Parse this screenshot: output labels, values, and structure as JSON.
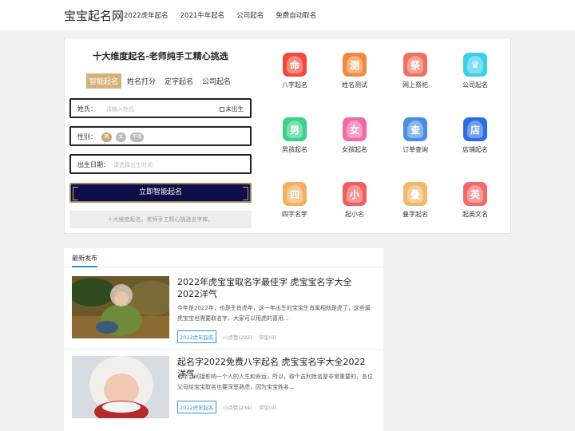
{
  "header": {
    "logo": "宝宝起名网",
    "nav": [
      "2022虎年起名",
      "2021牛年起名",
      "公司起名",
      "免费自动取名"
    ]
  },
  "form": {
    "title": "十大维度起名-老师纯手工精心挑选",
    "tabs": [
      "智能起名",
      "姓名打分",
      "定字起名",
      "公司起名"
    ],
    "surname_label": "姓氏：",
    "surname_placeholder": "请输入姓氏",
    "unborn_label": "未出生",
    "gender_label": "性别：",
    "genders": [
      "男",
      "女",
      "不限"
    ],
    "birth_label": "出生日期：",
    "birth_placeholder": "请选择出生时间",
    "submit_label": "立即智能起名",
    "note": "十大维度起名，老师手工精心挑选名字库。"
  },
  "services": [
    {
      "label": "八字起名",
      "icon": "bazi-icon",
      "glyph": "命",
      "color": "#f04a3a"
    },
    {
      "label": "姓名测试",
      "icon": "name-test-icon",
      "glyph": "测",
      "color": "#f08a3c"
    },
    {
      "label": "网上祭祀",
      "icon": "memorial-icon",
      "glyph": "祭",
      "color": "#f07060"
    },
    {
      "label": "公司起名",
      "icon": "company-crown-icon",
      "glyph": "♛",
      "color": "#3ad0e8"
    },
    {
      "label": "男孩起名",
      "icon": "boy-icon",
      "glyph": "男",
      "color": "#3cd08a"
    },
    {
      "label": "女孩起名",
      "icon": "girl-icon",
      "glyph": "女",
      "color": "#f06aa8"
    },
    {
      "label": "订单查询",
      "icon": "order-query-icon",
      "glyph": "查",
      "color": "#4a8ee0"
    },
    {
      "label": "店铺起名",
      "icon": "shop-icon",
      "glyph": "店",
      "color": "#2a6ee0"
    },
    {
      "label": "四字名字",
      "icon": "four-char-icon",
      "glyph": "四",
      "color": "#f0b060"
    },
    {
      "label": "起小名",
      "icon": "nickname-icon",
      "glyph": "小",
      "color": "#f06060"
    },
    {
      "label": "叠字起名",
      "icon": "repeat-char-icon",
      "glyph": "叠",
      "color": "#f0b86a"
    },
    {
      "label": "起英文名",
      "icon": "english-name-icon",
      "glyph": "英",
      "color": "#f06a6a"
    }
  ],
  "news": {
    "heading": "最新发布",
    "articles": [
      {
        "title": "2022年虎宝宝取名字最佳字 虎宝宝名字大全2022洋气",
        "summary": "今年是2022年，也是生肖虎年，这一年出生的宝宝生肖属相就是虎了，这些属虎宝宝也需要取名字，大家可以用虎的喜用...",
        "tag": "2022虎年起名",
        "likes": "点赞(292)",
        "comments": "评论(0)"
      },
      {
        "title": "起名字2022免费八字起名 虎宝宝名字大全2022洋气",
        "summary": "名字会间接影响一个人的人生和命运，所以，取个吉利姓名是非常重要的，各位父母给宝宝取名也要深思熟虑，因为宝宝姓名...",
        "tag": "2022虎年起名",
        "likes": "点赞(234)",
        "comments": "评论(0)"
      }
    ]
  }
}
